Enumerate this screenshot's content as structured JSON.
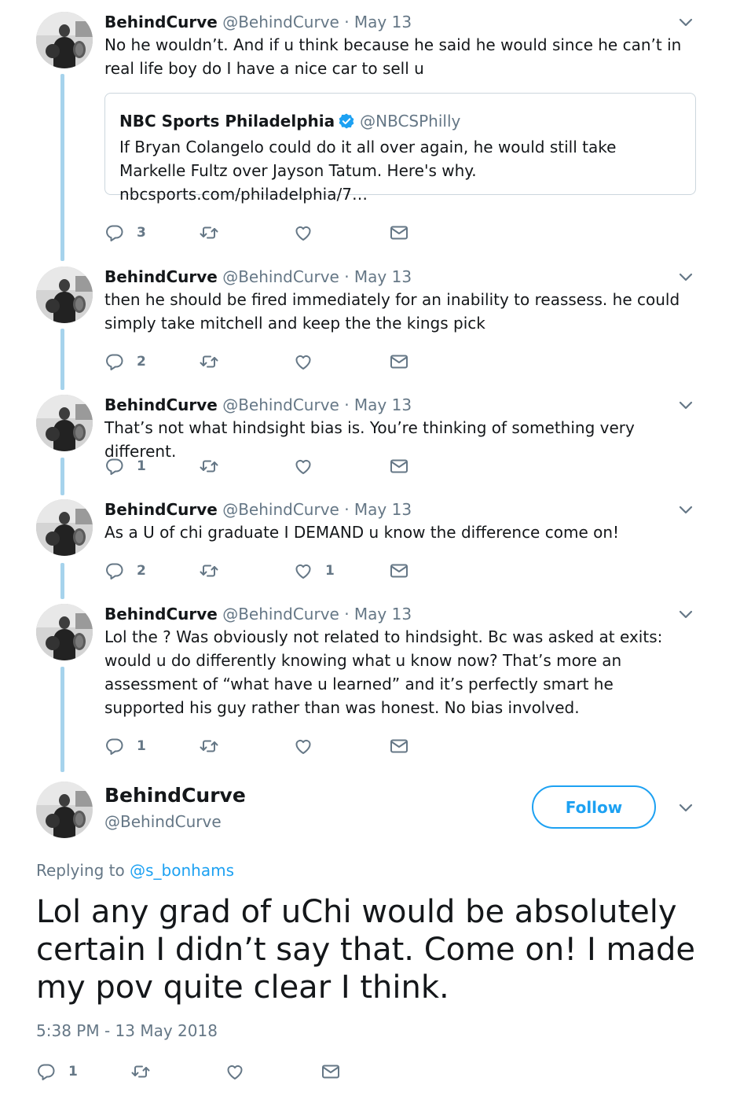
{
  "replies": [
    {
      "name": "BehindCurve",
      "handle": "@BehindCurve",
      "separator": "·",
      "date": "May 13",
      "text": "No he wouldn’t. And if u think because he said he would since he can’t in real life boy do I have a nice car to sell u",
      "quote": {
        "name": "NBC Sports Philadelphia",
        "handle": "@NBCSPhilly",
        "text": "If Bryan Colangelo could do it all over again, he would still take Markelle Fultz over Jayson Tatum. Here's why. nbcsports.com/philadelphia/7…"
      },
      "reply_count": "3",
      "retweet_count": "",
      "like_count": ""
    },
    {
      "name": "BehindCurve",
      "handle": "@BehindCurve",
      "separator": "·",
      "date": "May 13",
      "text": "then he should be fired immediately for an inability to reassess. he could simply take mitchell and keep the the kings pick",
      "reply_count": "2",
      "retweet_count": "",
      "like_count": ""
    },
    {
      "name": "BehindCurve",
      "handle": "@BehindCurve",
      "separator": "·",
      "date": "May 13",
      "text": "That’s not what hindsight bias is. You’re thinking of something very different.",
      "reply_count": "1",
      "retweet_count": "",
      "like_count": ""
    },
    {
      "name": "BehindCurve",
      "handle": "@BehindCurve",
      "separator": "·",
      "date": "May 13",
      "text": "As a U of chi graduate I DEMAND u know the difference come on!",
      "reply_count": "2",
      "retweet_count": "",
      "like_count": "1"
    },
    {
      "name": "BehindCurve",
      "handle": "@BehindCurve",
      "separator": "·",
      "date": "May 13",
      "text": "Lol the ? Was obviously not related to hindsight. Bc was asked at exits: would u do differently knowing what u know now? That’s more an assessment of “what have u learned” and it’s perfectly smart he supported his guy rather than was honest. No bias involved.",
      "reply_count": "1",
      "retweet_count": "",
      "like_count": ""
    }
  ],
  "main_tweet": {
    "name": "BehindCurve",
    "handle": "@BehindCurve",
    "follow_label": "Follow",
    "replying_prefix": "Replying to",
    "replying_to": "@s_bonhams",
    "text": "Lol any grad of uChi would be absolutely certain I didn’t say that. Come on! I made my pov quite clear I think.",
    "timestamp": "5:38 PM - 13 May 2018",
    "reply_count": "1",
    "retweet_count": "",
    "like_count": ""
  },
  "icons": {
    "reply": "reply-icon",
    "retweet": "retweet-icon",
    "like": "heart-icon",
    "dm": "envelope-icon",
    "more": "chevron-down-icon",
    "verified": "verified-badge-icon"
  },
  "colors": {
    "thread_line": "#a6d3ec",
    "accent": "#1da1f2",
    "secondary_text": "#657786",
    "border": "#ccd6dd"
  }
}
